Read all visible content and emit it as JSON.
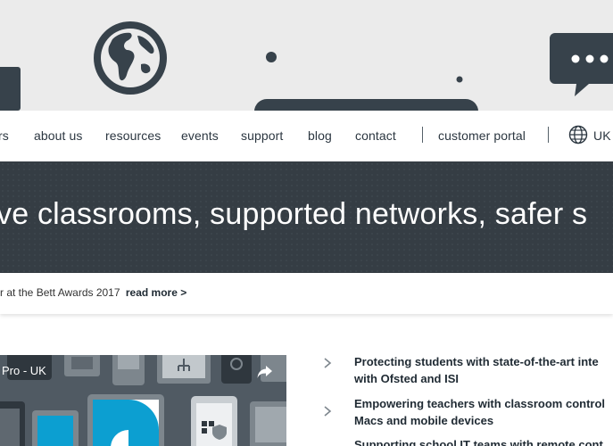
{
  "nav": {
    "items": [
      {
        "label": "rs"
      },
      {
        "label": "about us"
      },
      {
        "label": "resources"
      },
      {
        "label": "events"
      },
      {
        "label": "support"
      },
      {
        "label": "blog"
      },
      {
        "label": "contact"
      },
      {
        "label": "customer portal"
      }
    ],
    "region_label": "UK"
  },
  "banner": {
    "headline": "ve classrooms, supported networks, safer s"
  },
  "news": {
    "text": "r at the Bett Awards 2017",
    "link": "read more >"
  },
  "video": {
    "title": "Pro - UK"
  },
  "features": [
    {
      "line1": "Protecting students with state-of-the-art inte",
      "line2": "with Ofsted and ISI"
    },
    {
      "line1": "Empowering teachers with classroom control",
      "line2": "Macs and mobile devices"
    },
    {
      "line1": "Supporting school IT teams with remote cont",
      "line2": ""
    }
  ],
  "colors": {
    "hero_bg": "#ebebeb",
    "illustration": "#37424b",
    "banner_bg": "#353d44",
    "text_dark": "#1f2a33",
    "video_bg": "#505a63",
    "accent_blue": "#0c9fd1"
  },
  "icons": {
    "hero": [
      "globe-illustration",
      "chat-bubble-illustration"
    ],
    "nav": "globe-icon",
    "list": "chevron-right-icon",
    "video": "share-icon"
  }
}
